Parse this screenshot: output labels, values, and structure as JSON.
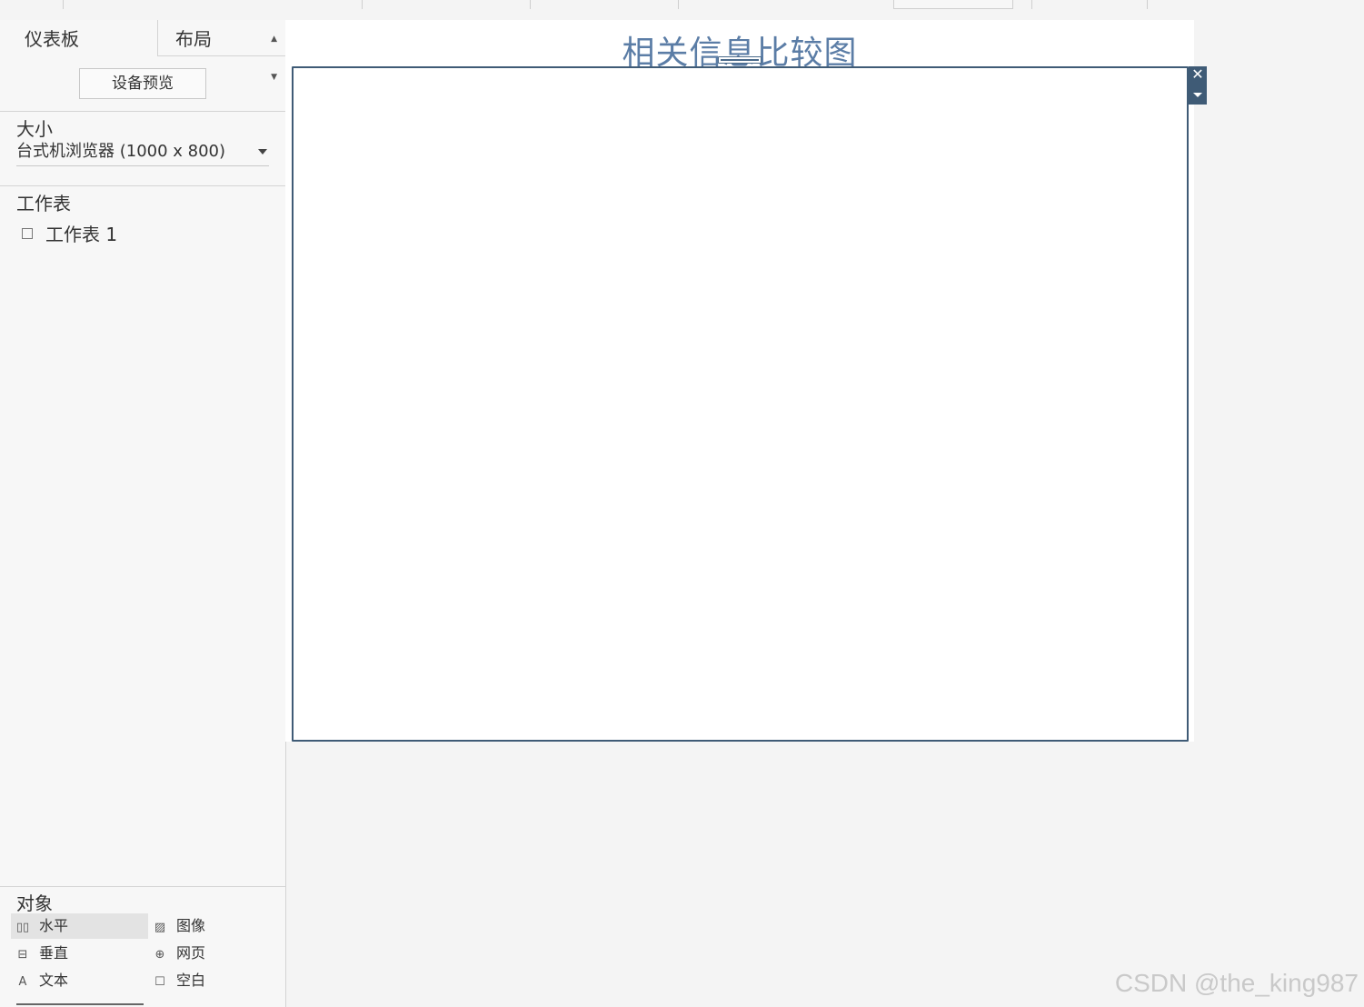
{
  "sidebar": {
    "tabs": [
      {
        "label": "仪表板"
      },
      {
        "label": "布局"
      }
    ],
    "preview_button": "设备预览",
    "size": {
      "title": "大小",
      "selected": "台式机浏览器 (1000 x 800)"
    },
    "sheets": {
      "title": "工作表",
      "items": [
        {
          "label": "工作表 1"
        }
      ]
    },
    "objects": {
      "title": "对象",
      "items": [
        {
          "label": "水平",
          "icon": "horizontal-container-icon"
        },
        {
          "label": "图像",
          "icon": "image-icon"
        },
        {
          "label": "垂直",
          "icon": "vertical-container-icon"
        },
        {
          "label": "网页",
          "icon": "globe-icon"
        },
        {
          "label": "文本",
          "icon": "text-icon"
        },
        {
          "label": "空白",
          "icon": "blank-icon"
        }
      ]
    }
  },
  "canvas": {
    "title": "相关信息比较图"
  },
  "watermark": "CSDN @the_king987",
  "colors": {
    "title": "#5b7da6",
    "frame": "#3f5b76"
  }
}
